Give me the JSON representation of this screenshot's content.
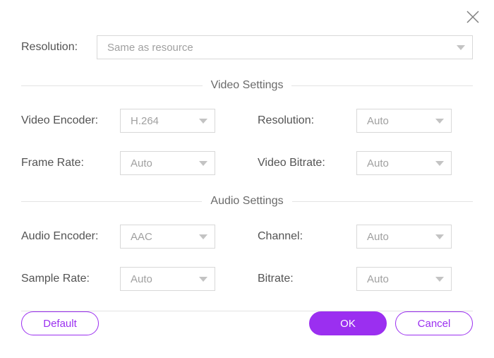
{
  "top": {
    "resolution_label": "Resolution:",
    "resolution_value": "Same as resource"
  },
  "video": {
    "section_title": "Video Settings",
    "encoder_label": "Video Encoder:",
    "encoder_value": "H.264",
    "resolution_label": "Resolution:",
    "resolution_value": "Auto",
    "framerate_label": "Frame Rate:",
    "framerate_value": "Auto",
    "bitrate_label": "Video Bitrate:",
    "bitrate_value": "Auto"
  },
  "audio": {
    "section_title": "Audio Settings",
    "encoder_label": "Audio Encoder:",
    "encoder_value": "AAC",
    "channel_label": "Channel:",
    "channel_value": "Auto",
    "samplerate_label": "Sample Rate:",
    "samplerate_value": "Auto",
    "bitrate_label": "Bitrate:",
    "bitrate_value": "Auto"
  },
  "buttons": {
    "default": "Default",
    "ok": "OK",
    "cancel": "Cancel"
  }
}
